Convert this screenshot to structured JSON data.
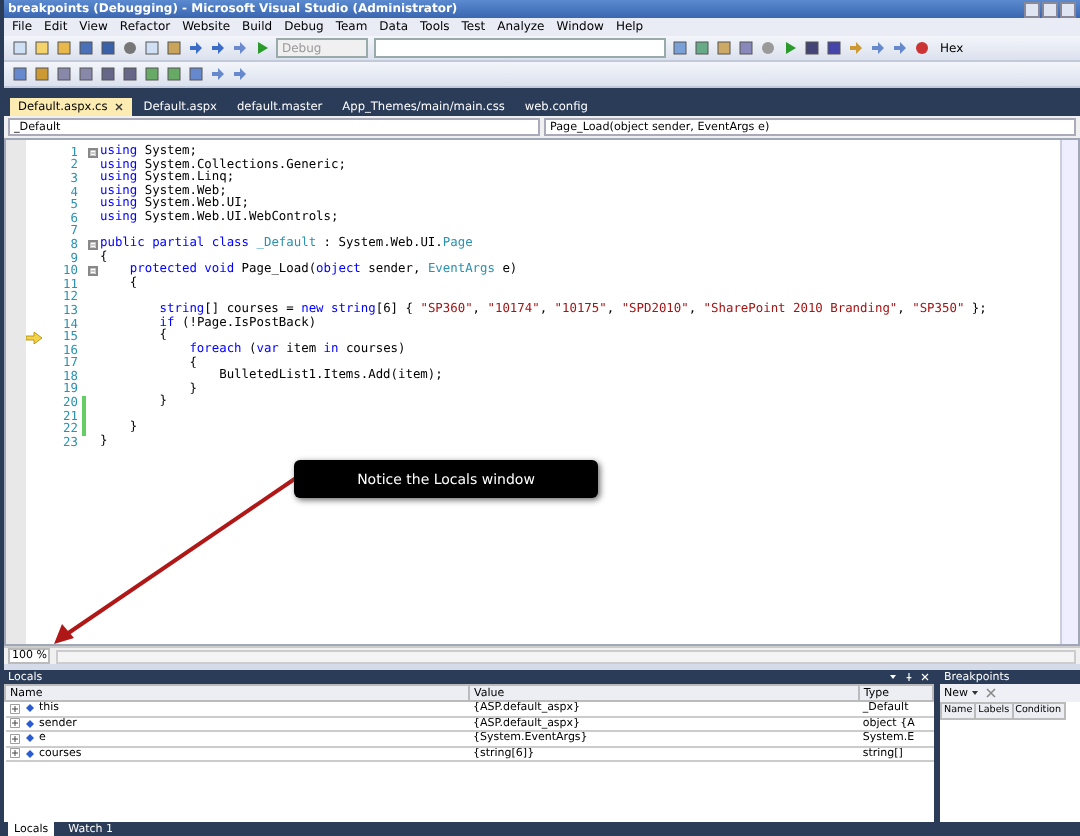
{
  "window": {
    "title": "breakpoints (Debugging) - Microsoft Visual Studio (Administrator)"
  },
  "menu": [
    "File",
    "Edit",
    "View",
    "Refactor",
    "Website",
    "Build",
    "Debug",
    "Team",
    "Data",
    "Tools",
    "Test",
    "Analyze",
    "Window",
    "Help"
  ],
  "toolbar": {
    "configuration": "Debug",
    "hex_button": "Hex"
  },
  "tabs": [
    {
      "label": "Default.aspx.cs",
      "selected": true
    },
    {
      "label": "Default.aspx",
      "selected": false
    },
    {
      "label": "default.master",
      "selected": false
    },
    {
      "label": "App_Themes/main/main.css",
      "selected": false
    },
    {
      "label": "web.config",
      "selected": false
    }
  ],
  "navigation": {
    "class": "_Default",
    "member": "Page_Load(object sender, EventArgs e)"
  },
  "code": [
    {
      "number": "1",
      "fold": true,
      "current": false,
      "changed": false,
      "tokens": [
        {
          "kind": "keyword",
          "text": "using"
        },
        {
          "kind": "plain",
          "text": " System;"
        }
      ]
    },
    {
      "number": "2",
      "fold": false,
      "current": false,
      "changed": false,
      "tokens": [
        {
          "kind": "keyword",
          "text": "using"
        },
        {
          "kind": "plain",
          "text": " System.Collections.Generic;"
        }
      ]
    },
    {
      "number": "3",
      "fold": false,
      "current": false,
      "changed": false,
      "tokens": [
        {
          "kind": "keyword",
          "text": "using"
        },
        {
          "kind": "plain",
          "text": " System.Linq;"
        }
      ]
    },
    {
      "number": "4",
      "fold": false,
      "current": false,
      "changed": false,
      "tokens": [
        {
          "kind": "keyword",
          "text": "using"
        },
        {
          "kind": "plain",
          "text": " System.Web;"
        }
      ]
    },
    {
      "number": "5",
      "fold": false,
      "current": false,
      "changed": false,
      "tokens": [
        {
          "kind": "keyword",
          "text": "using"
        },
        {
          "kind": "plain",
          "text": " System.Web.UI;"
        }
      ]
    },
    {
      "number": "6",
      "fold": false,
      "current": false,
      "changed": false,
      "tokens": [
        {
          "kind": "keyword",
          "text": "using"
        },
        {
          "kind": "plain",
          "text": " System.Web.UI.WebControls;"
        }
      ]
    },
    {
      "number": "7",
      "fold": false,
      "current": false,
      "changed": false
    },
    {
      "number": "8",
      "fold": true,
      "current": false,
      "changed": false,
      "tokens": [
        {
          "kind": "keyword",
          "text": "public partial class"
        },
        {
          "kind": "type",
          "text": " _Default"
        },
        {
          "kind": "plain",
          "text": " : System.Web.UI."
        },
        {
          "kind": "type",
          "text": "Page"
        }
      ]
    },
    {
      "number": "9",
      "fold": false,
      "current": false,
      "changed": false,
      "tokens": [
        {
          "kind": "plain",
          "text": "{"
        }
      ]
    },
    {
      "number": "10",
      "fold": true,
      "current": false,
      "changed": false,
      "tokens": [
        {
          "kind": "keyword",
          "text": "    protected void"
        },
        {
          "kind": "plain",
          "text": " Page_Load("
        },
        {
          "kind": "keyword",
          "text": "object"
        },
        {
          "kind": "plain",
          "text": " sender, "
        },
        {
          "kind": "type",
          "text": "EventArgs"
        },
        {
          "kind": "plain",
          "text": " e)"
        }
      ]
    },
    {
      "number": "11",
      "fold": false,
      "current": false,
      "changed": false,
      "tokens": [
        {
          "kind": "plain",
          "text": "    {"
        }
      ]
    },
    {
      "number": "12",
      "fold": false,
      "current": false,
      "changed": false
    },
    {
      "number": "13",
      "fold": false,
      "current": false,
      "changed": false,
      "tokens": [
        {
          "kind": "keyword",
          "text": "        string"
        },
        {
          "kind": "plain",
          "text": "[] courses = "
        },
        {
          "kind": "keyword",
          "text": "new string"
        },
        {
          "kind": "plain",
          "text": "[6] { "
        },
        {
          "kind": "string",
          "text": "\"SP360\""
        },
        {
          "kind": "plain",
          "text": ", "
        },
        {
          "kind": "string",
          "text": "\"10174\""
        },
        {
          "kind": "plain",
          "text": ", "
        },
        {
          "kind": "string",
          "text": "\"10175\""
        },
        {
          "kind": "plain",
          "text": ", "
        },
        {
          "kind": "string",
          "text": "\"SPD2010\""
        },
        {
          "kind": "plain",
          "text": ", "
        },
        {
          "kind": "string",
          "text": "\"SharePoint 2010 Branding\""
        },
        {
          "kind": "plain",
          "text": ", "
        },
        {
          "kind": "string",
          "text": "\"SP350\""
        },
        {
          "kind": "plain",
          "text": " };"
        }
      ]
    },
    {
      "number": "14",
      "fold": false,
      "current": false,
      "changed": false,
      "tokens": [
        {
          "kind": "keyword",
          "text": "        if"
        },
        {
          "kind": "plain",
          "text": " (!Page.IsPostBack)"
        }
      ]
    },
    {
      "number": "15",
      "fold": false,
      "current": true,
      "changed": false,
      "tokens": [
        {
          "kind": "plain",
          "text": "        {"
        }
      ]
    },
    {
      "number": "16",
      "fold": false,
      "current": false,
      "changed": false,
      "tokens": [
        {
          "kind": "keyword",
          "text": "            foreach"
        },
        {
          "kind": "plain",
          "text": " ("
        },
        {
          "kind": "keyword",
          "text": "var"
        },
        {
          "kind": "plain",
          "text": " item "
        },
        {
          "kind": "keyword",
          "text": "in"
        },
        {
          "kind": "plain",
          "text": " courses)"
        }
      ]
    },
    {
      "number": "17",
      "fold": false,
      "current": false,
      "changed": false,
      "tokens": [
        {
          "kind": "plain",
          "text": "            {"
        }
      ]
    },
    {
      "number": "18",
      "fold": false,
      "current": false,
      "changed": false,
      "tokens": [
        {
          "kind": "plain",
          "text": "                BulletedList1.Items.Add(item);"
        }
      ]
    },
    {
      "number": "19",
      "fold": false,
      "current": false,
      "changed": false,
      "tokens": [
        {
          "kind": "plain",
          "text": "            }"
        }
      ]
    },
    {
      "number": "20",
      "fold": false,
      "current": false,
      "changed": true,
      "tokens": [
        {
          "kind": "plain",
          "text": "        }"
        }
      ]
    },
    {
      "number": "21",
      "fold": false,
      "current": false,
      "changed": true
    },
    {
      "number": "22",
      "fold": false,
      "current": false,
      "changed": true,
      "tokens": [
        {
          "kind": "plain",
          "text": "    }"
        }
      ]
    },
    {
      "number": "23",
      "fold": false,
      "current": false,
      "changed": false,
      "tokens": [
        {
          "kind": "plain",
          "text": "}"
        }
      ]
    }
  ],
  "callout": {
    "text": "Notice the Locals window"
  },
  "zoom": "100 %",
  "locals": {
    "title": "Locals",
    "columns": [
      "Name",
      "Value",
      "Type"
    ],
    "rows": [
      {
        "name": "this",
        "value": "{ASP.default_aspx}",
        "type": "_Default",
        "expanded": false
      },
      {
        "name": "sender",
        "value": "{ASP.default_aspx}",
        "type": "object {A",
        "expanded": false
      },
      {
        "name": "e",
        "value": "{System.EventArgs}",
        "type": "System.E",
        "expanded": false
      },
      {
        "name": "courses",
        "value": "{string[6]}",
        "type": "string[]",
        "expanded": false
      }
    ]
  },
  "breakpoints": {
    "title": "Breakpoints",
    "new_button": "New",
    "columns": [
      "Name",
      "Labels",
      "Condition"
    ]
  },
  "bottom_tabs": [
    {
      "label": "Locals",
      "selected": true
    },
    {
      "label": "Watch 1",
      "selected": false
    }
  ]
}
